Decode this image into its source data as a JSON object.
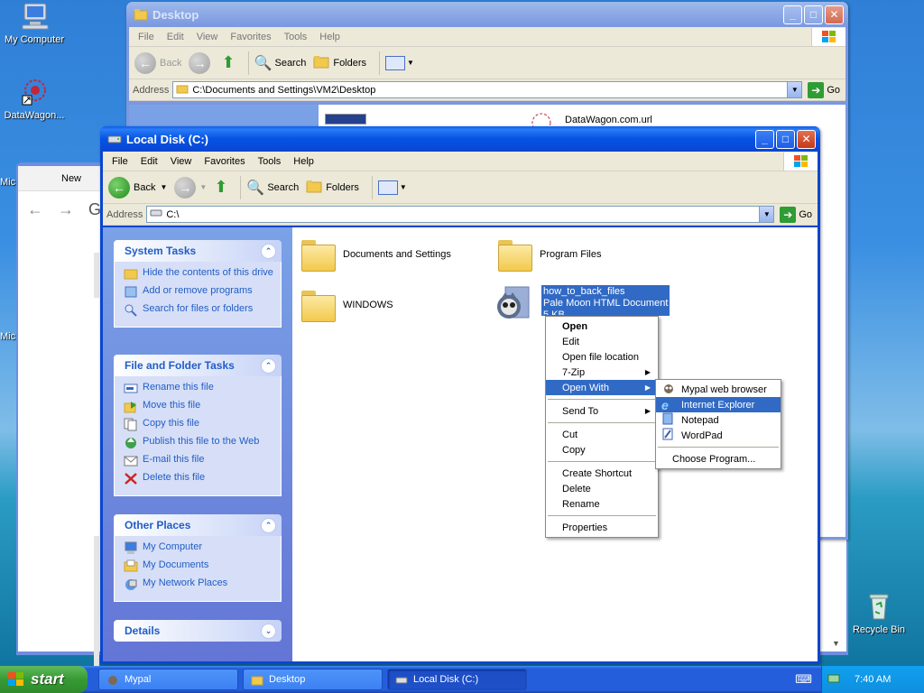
{
  "desktop": {
    "icons": [
      {
        "label": "My Computer"
      },
      {
        "label": "DataWagon..."
      },
      {
        "label": "Mic"
      },
      {
        "label": "Mic"
      },
      {
        "label": "Recycle Bin"
      }
    ]
  },
  "bg_window": {
    "tab_label": "New",
    "address_letter": "G"
  },
  "desktop_window": {
    "title": "Desktop",
    "menu": [
      "File",
      "Edit",
      "View",
      "Favorites",
      "Tools",
      "Help"
    ],
    "toolbar": {
      "back": "Back",
      "search": "Search",
      "folders": "Folders"
    },
    "address_label": "Address",
    "address": "C:\\Documents and Settings\\VM2\\Desktop",
    "go": "Go",
    "file": "DataWagon.com.url"
  },
  "local_window": {
    "title": "Local Disk (C:)",
    "menu": [
      "File",
      "Edit",
      "View",
      "Favorites",
      "Tools",
      "Help"
    ],
    "toolbar": {
      "back": "Back",
      "search": "Search",
      "folders": "Folders"
    },
    "address_label": "Address",
    "address": "C:\\",
    "go": "Go",
    "system_tasks": {
      "title": "System Tasks",
      "items": [
        "Hide the contents of this drive",
        "Add or remove programs",
        "Search for files or folders"
      ]
    },
    "file_folder_tasks": {
      "title": "File and Folder Tasks",
      "items": [
        "Rename this file",
        "Move this file",
        "Copy this file",
        "Publish this file to the Web",
        "E-mail this file",
        "Delete this file"
      ]
    },
    "other_places": {
      "title": "Other Places",
      "items": [
        "My Computer",
        "My Documents",
        "My Network Places"
      ]
    },
    "details": {
      "title": "Details"
    },
    "files": [
      {
        "name": "Documents and Settings"
      },
      {
        "name": "Program Files"
      },
      {
        "name": "WINDOWS"
      },
      {
        "name": "how_to_back_files",
        "type": "Pale Moon HTML Document",
        "size": "5 KB"
      }
    ]
  },
  "context_menu": {
    "items": [
      "Open",
      "Edit",
      "Open file location",
      "7-Zip",
      "Open With",
      "Send To",
      "Cut",
      "Copy",
      "Create Shortcut",
      "Delete",
      "Rename",
      "Properties"
    ],
    "selected": "Open With"
  },
  "open_with_menu": {
    "items": [
      "Mypal web browser",
      "Internet Explorer",
      "Notepad",
      "WordPad",
      "Choose Program..."
    ],
    "selected": "Internet Explorer"
  },
  "taskbar": {
    "start": "start",
    "tasks": [
      "Mypal",
      "Desktop",
      "Local Disk (C:)"
    ],
    "active": "Local Disk (C:)",
    "clock": "7:40 AM"
  },
  "colors": {
    "xp_blue": "#0a46d0",
    "menu_highlight": "#316ac5",
    "task_link": "#215dc6",
    "start_green": "#379a34"
  }
}
